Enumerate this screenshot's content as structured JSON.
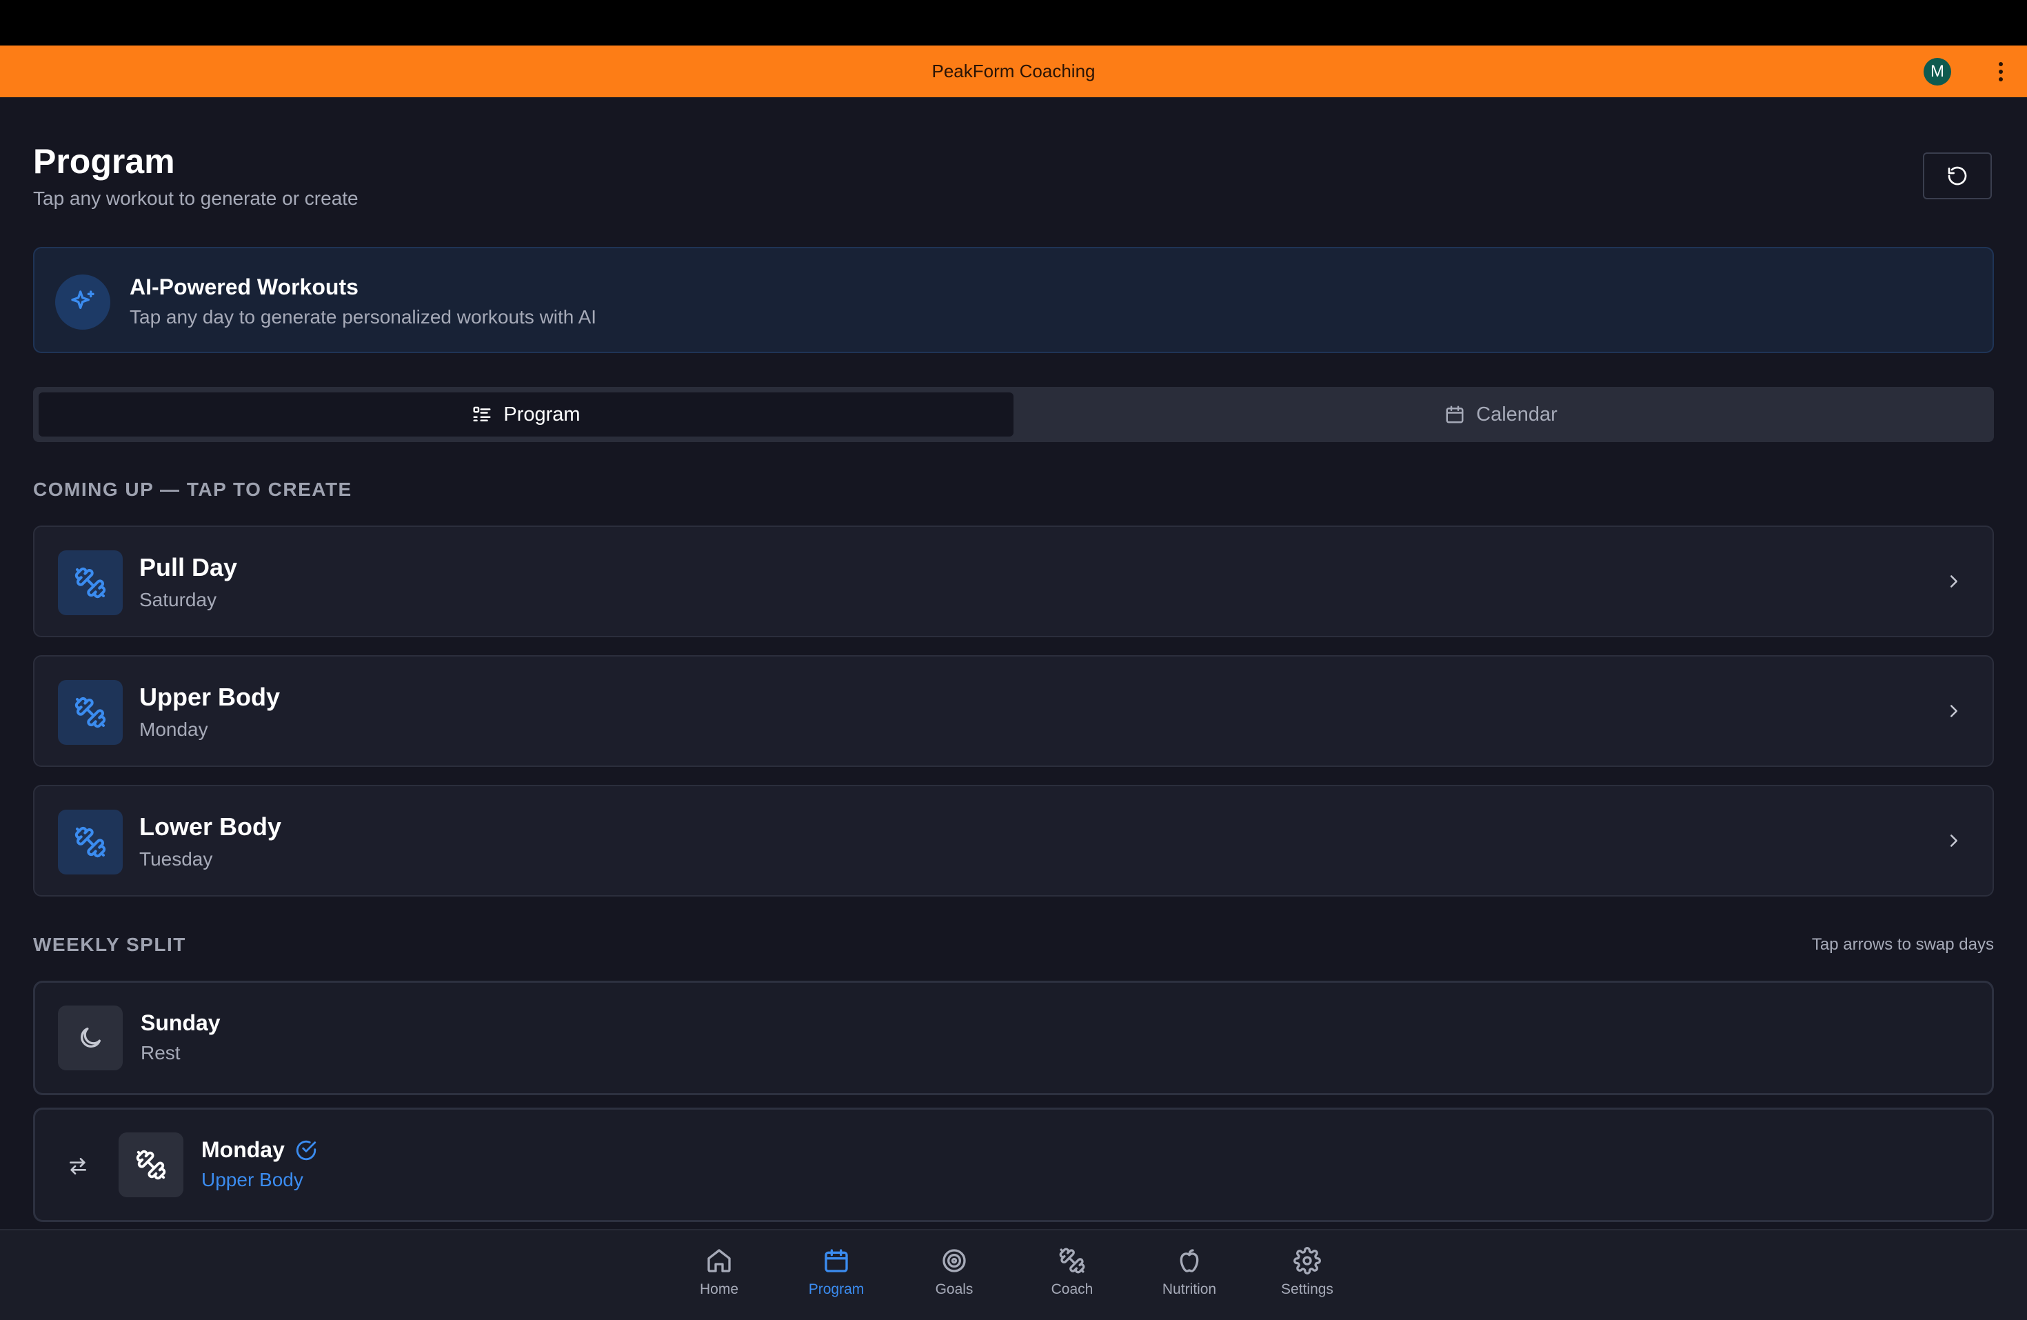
{
  "app": {
    "title": "PeakForm Coaching",
    "avatar_initial": "M"
  },
  "page": {
    "title": "Program",
    "subtitle": "Tap any workout to generate or create"
  },
  "ai_banner": {
    "title": "AI-Powered Workouts",
    "subtitle": "Tap any day to generate personalized workouts with AI"
  },
  "tabs": [
    {
      "label": "Program",
      "icon": "list-icon",
      "active": true
    },
    {
      "label": "Calendar",
      "icon": "calendar-icon",
      "active": false
    }
  ],
  "coming_up": {
    "heading": "COMING UP — TAP TO CREATE",
    "items": [
      {
        "title": "Pull Day",
        "day": "Saturday",
        "icon": "dumbbell-icon"
      },
      {
        "title": "Upper Body",
        "day": "Monday",
        "icon": "dumbbell-icon"
      },
      {
        "title": "Lower Body",
        "day": "Tuesday",
        "icon": "dumbbell-icon"
      }
    ]
  },
  "weekly_split": {
    "heading": "WEEKLY SPLIT",
    "hint": "Tap arrows to swap days",
    "days": [
      {
        "day": "Sunday",
        "workout": "Rest",
        "icon": "moon-icon"
      },
      {
        "day": "Monday",
        "workout": "Upper Body",
        "icon": "dumbbell-icon",
        "completed": true
      }
    ]
  },
  "nav": [
    {
      "label": "Home",
      "icon": "home-icon",
      "active": false
    },
    {
      "label": "Program",
      "icon": "calendar-icon",
      "active": true
    },
    {
      "label": "Goals",
      "icon": "target-icon",
      "active": false
    },
    {
      "label": "Coach",
      "icon": "dumbbell-icon",
      "active": false
    },
    {
      "label": "Nutrition",
      "icon": "apple-icon",
      "active": false
    },
    {
      "label": "Settings",
      "icon": "gear-icon",
      "active": false
    }
  ],
  "colors": {
    "accent": "#fd7d16",
    "primary": "#3b8cf0",
    "background": "#151621"
  }
}
